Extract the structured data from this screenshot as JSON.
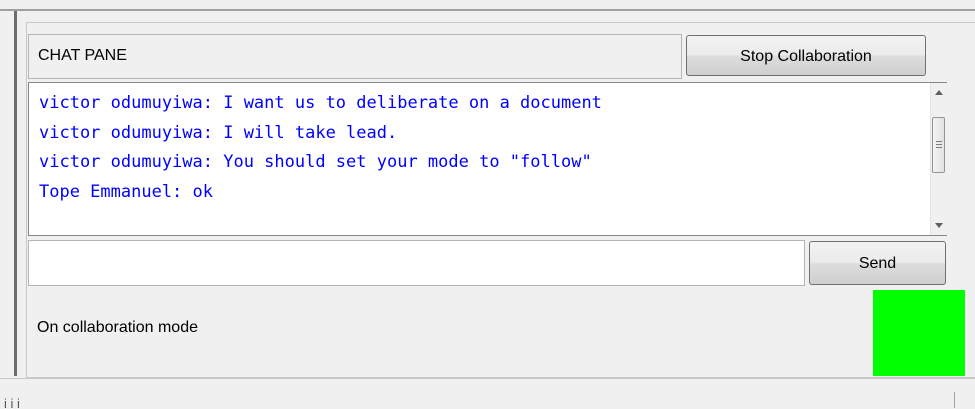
{
  "chat": {
    "pane_label": "CHAT PANE",
    "stop_button_label": "Stop Collaboration",
    "messages": [
      "victor odumuyiwa: I want us to deliberate on a document",
      "victor odumuyiwa: I will take lead.",
      "victor odumuyiwa: You should set your mode to \"follow\"",
      "Tope Emmanuel: ok"
    ],
    "input_value": "",
    "send_button_label": "Send"
  },
  "status": {
    "text": "On collaboration mode",
    "indicator_color": "#00ff00"
  },
  "bottom_bar": {
    "partial_text": "i i i "
  }
}
